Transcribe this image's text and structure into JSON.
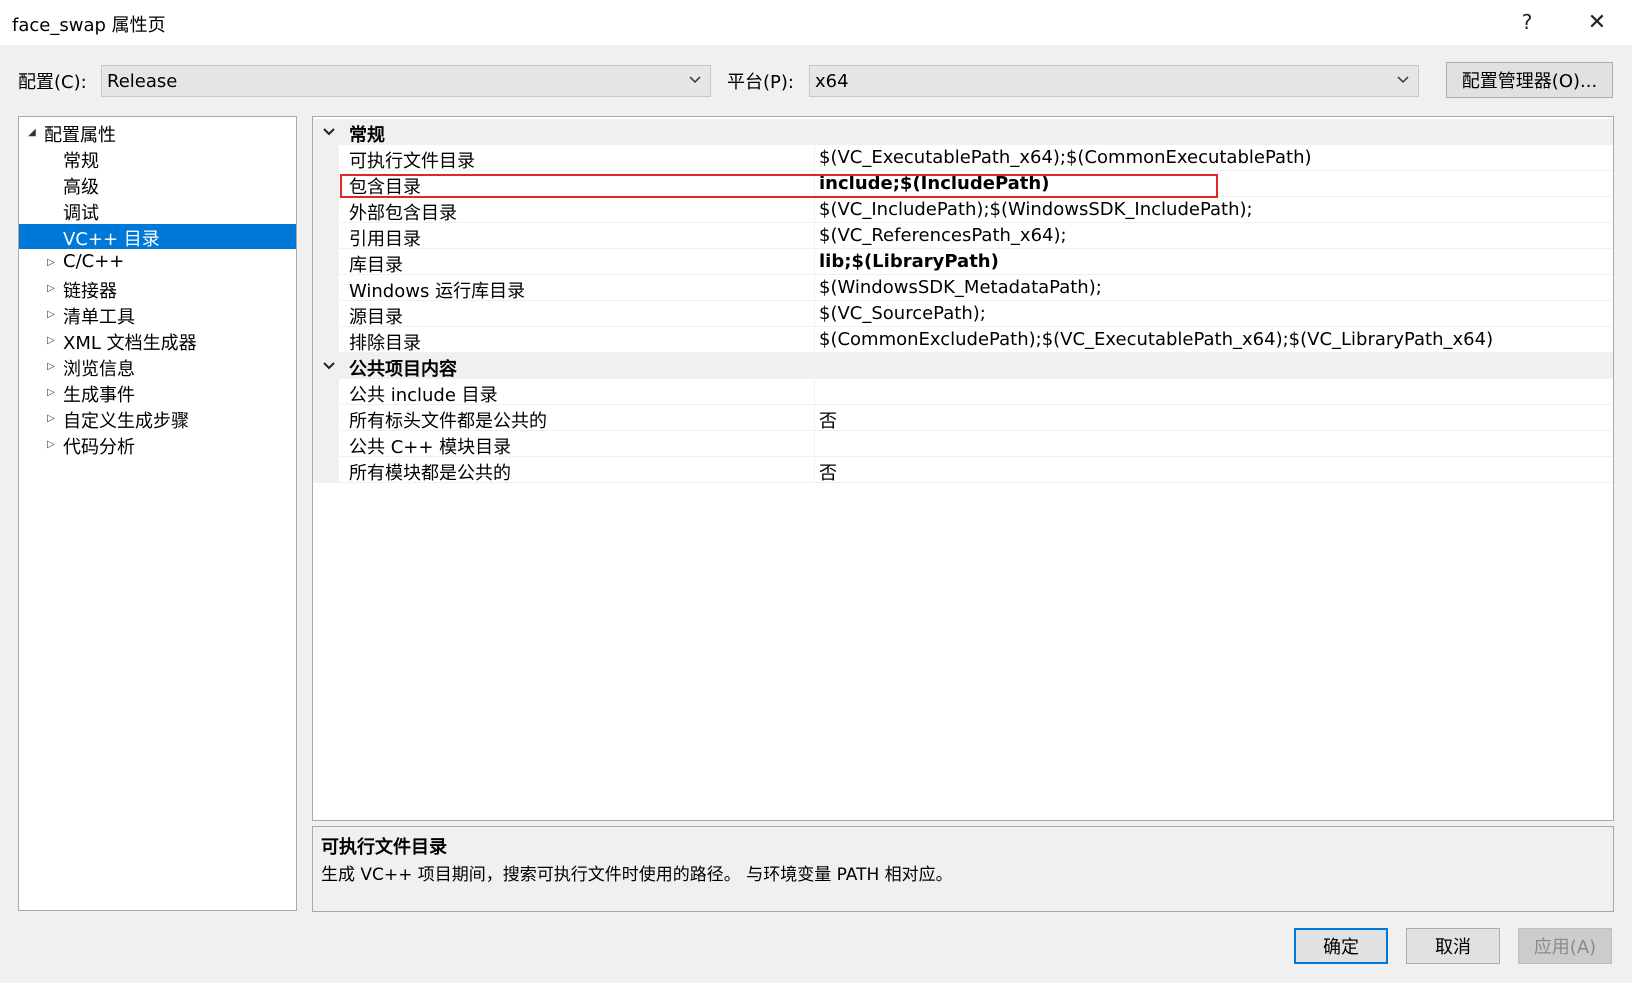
{
  "window": {
    "title": "face_swap 属性页",
    "help_glyph": "?",
    "close_glyph": "✕"
  },
  "toolbar": {
    "config_label": "配置(C):",
    "config_value": "Release",
    "platform_label": "平台(P):",
    "platform_value": "x64",
    "config_manager_label": "配置管理器(O)..."
  },
  "tree": {
    "root": "配置属性",
    "items": [
      {
        "label": "常规",
        "expandable": false
      },
      {
        "label": "高级",
        "expandable": false
      },
      {
        "label": "调试",
        "expandable": false
      },
      {
        "label": "VC++ 目录",
        "expandable": false,
        "selected": true
      },
      {
        "label": "C/C++",
        "expandable": true
      },
      {
        "label": "链接器",
        "expandable": true
      },
      {
        "label": "清单工具",
        "expandable": true
      },
      {
        "label": "XML 文档生成器",
        "expandable": true
      },
      {
        "label": "浏览信息",
        "expandable": true
      },
      {
        "label": "生成事件",
        "expandable": true
      },
      {
        "label": "自定义生成步骤",
        "expandable": true
      },
      {
        "label": "代码分析",
        "expandable": true
      }
    ]
  },
  "grid": {
    "groups": [
      {
        "name": "常规",
        "rows": [
          {
            "name": "可执行文件目录",
            "value": "$(VC_ExecutablePath_x64);$(CommonExecutablePath)",
            "bold": false
          },
          {
            "name": "包含目录",
            "value": "include;$(IncludePath)",
            "bold": true
          },
          {
            "name": "外部包含目录",
            "value": "$(VC_IncludePath);$(WindowsSDK_IncludePath);",
            "bold": false
          },
          {
            "name": "引用目录",
            "value": "$(VC_ReferencesPath_x64);",
            "bold": false
          },
          {
            "name": "库目录",
            "value": "lib;$(LibraryPath)",
            "bold": true
          },
          {
            "name": "Windows 运行库目录",
            "value": "$(WindowsSDK_MetadataPath);",
            "bold": false
          },
          {
            "name": "源目录",
            "value": "$(VC_SourcePath);",
            "bold": false
          },
          {
            "name": "排除目录",
            "value": "$(CommonExcludePath);$(VC_ExecutablePath_x64);$(VC_LibraryPath_x64)",
            "bold": false
          }
        ]
      },
      {
        "name": "公共项目内容",
        "rows": [
          {
            "name": "公共 include 目录",
            "value": "",
            "bold": false
          },
          {
            "name": "所有标头文件都是公共的",
            "value": "否",
            "bold": false
          },
          {
            "name": "公共 C++ 模块目录",
            "value": "",
            "bold": false
          },
          {
            "name": "所有模块都是公共的",
            "value": "否",
            "bold": false
          }
        ]
      }
    ]
  },
  "description": {
    "title": "可执行文件目录",
    "text": "生成 VC++ 项目期间，搜索可执行文件时使用的路径。 与环境变量 PATH 相对应。"
  },
  "buttons": {
    "ok": "确定",
    "cancel": "取消",
    "apply": "应用(A)"
  },
  "colors": {
    "selection": "#0078d7",
    "highlight_box": "#e0262a"
  }
}
